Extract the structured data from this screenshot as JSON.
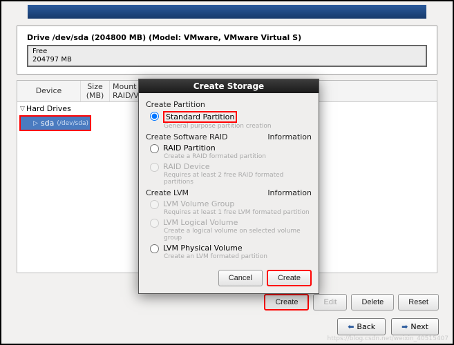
{
  "drive": {
    "title": "Drive /dev/sda (204800 MB) (Model: VMware, VMware Virtual S)",
    "free_label": "Free",
    "free_size": "204797 MB"
  },
  "table": {
    "headers": {
      "device": "Device",
      "size": "Size\n(MB)",
      "mount": "Mount P\nRAID/Vo"
    },
    "rows": {
      "hard_drives": "Hard Drives",
      "sda_name": "sda",
      "sda_path": "(/dev/sda)"
    }
  },
  "dialog": {
    "title": "Create Storage",
    "sections": {
      "partition": "Create Partition",
      "raid": "Create Software RAID",
      "lvm": "Create LVM",
      "info": "Information"
    },
    "options": {
      "standard": {
        "label": "Standard Partition",
        "desc": "General purpose partition creation"
      },
      "raid_part": {
        "label": "RAID Partition",
        "desc": "Create a RAID formated partition"
      },
      "raid_dev": {
        "label": "RAID Device",
        "desc": "Requires at least 2 free RAID formated partitions"
      },
      "lvm_vg": {
        "label": "LVM Volume Group",
        "desc": "Requires at least 1 free LVM formated partition"
      },
      "lvm_lv": {
        "label": "LVM Logical Volume",
        "desc": "Create a logical volume on selected volume group"
      },
      "lvm_pv": {
        "label": "LVM Physical Volume",
        "desc": "Create an LVM formated partition"
      }
    },
    "buttons": {
      "cancel": "Cancel",
      "create": "Create"
    }
  },
  "buttons": {
    "create": "Create",
    "edit": "Edit",
    "delete": "Delete",
    "reset": "Reset",
    "back": "Back",
    "next": "Next"
  },
  "watermark": "https://blog.csdn.net/weixin_40515407"
}
